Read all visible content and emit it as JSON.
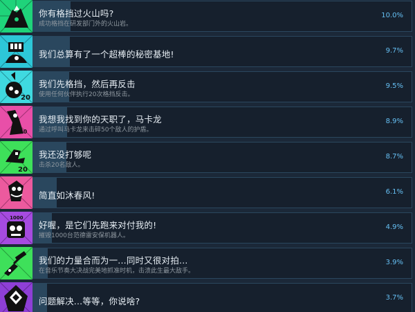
{
  "achievements": [
    {
      "title": "你有格挡过火山吗?",
      "description": "成功格挡在研发部门外的火山岩。",
      "percent": "10.0%",
      "percent_value": 10.0,
      "icon": "volcano-icon",
      "color": "#1fd37a"
    },
    {
      "title": "我们总算有了一个超棒的秘密基地!",
      "description": "",
      "percent": "9.7%",
      "percent_value": 9.7,
      "icon": "hand-lab-icon",
      "color": "#2dc7d8"
    },
    {
      "title": "我们先格挡，然后再反击",
      "description": "使用任何伙伴执行20次格挡反击。",
      "percent": "9.5%",
      "percent_value": 9.5,
      "icon": "parry-counter-icon",
      "color": "#3fd9e0"
    },
    {
      "title": "我想我找到你的天职了，马卡龙",
      "description": "通过呼叫马卡龙来击碎50个敌人的护盾。",
      "percent": "8.9%",
      "percent_value": 8.9,
      "icon": "macaron-icon",
      "color": "#e84fa8"
    },
    {
      "title": "我还没打够呢",
      "description": "击杀20名敌人。",
      "percent": "8.7%",
      "percent_value": 8.7,
      "icon": "kill-twenty-icon",
      "color": "#3ee05a"
    },
    {
      "title": "简直如沐春风!",
      "description": "",
      "percent": "6.1%",
      "percent_value": 6.1,
      "icon": "breeze-icon",
      "color": "#ec5a9e"
    },
    {
      "title": "好喔，是它们先跑来对付我的!",
      "description": "摧毁1000台范德雷安保机器人。",
      "percent": "4.9%",
      "percent_value": 4.9,
      "icon": "robot-1000-icon",
      "color": "#a64be0"
    },
    {
      "title": "我们的力量合而为一...同时又很对拍...",
      "description": "在音乐节奏大决战完美地抓准时机，击溃此生最大敌手。",
      "percent": "3.9%",
      "percent_value": 3.9,
      "icon": "guitar-icon",
      "color": "#3ee05a"
    },
    {
      "title": "问题解决...等等，你说啥?",
      "description": "",
      "percent": "3.7%",
      "percent_value": 3.7,
      "icon": "robot-face-icon",
      "color": "#8e3fd6"
    }
  ]
}
